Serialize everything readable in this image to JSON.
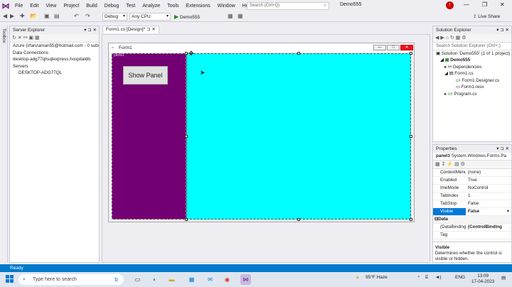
{
  "menu": {
    "items": [
      "File",
      "Edit",
      "View",
      "Project",
      "Build",
      "Debug",
      "Test",
      "Analyze",
      "Tools",
      "Extensions",
      "Window",
      "Help"
    ],
    "search_placeholder": "Search (Ctrl+Q)",
    "project_name": "Demo555",
    "user_initial": "!",
    "minimize": "—",
    "restore": "❐",
    "close": "✕"
  },
  "toolbar": {
    "config": "Debug",
    "platform": "Any CPU",
    "run_target": "Demo555",
    "live_share": "Live Share"
  },
  "toolbox_label": "Toolbox",
  "server_explorer": {
    "title": "Server Explorer",
    "items": [
      "Azure (irfanzaman55@hotmail.com - 0 subs",
      "Data Connections",
      "desktop-adg77ql\\sqlexpress.hospitaldb.",
      "Servers",
      "DESKTOP-ADG77QL"
    ]
  },
  "document": {
    "tab_label": "Form1.cs [Design]*",
    "form_title": "Form1",
    "panel_label": "panel1",
    "button_label": "Show Panel"
  },
  "solution_explorer": {
    "title": "Solution Explorer",
    "search_placeholder": "Search Solution Explorer (Ctrl+;)",
    "items": [
      {
        "text": "Solution 'Demo555' (1 of 1 project)",
        "indent": 0,
        "icon": "solution-icon"
      },
      {
        "text": "Demo555",
        "indent": 1,
        "icon": "csharp-project-icon"
      },
      {
        "text": "Dependencies",
        "indent": 2,
        "icon": "dependencies-icon"
      },
      {
        "text": "Form1.cs",
        "indent": 2,
        "icon": "form-icon"
      },
      {
        "text": "Form1.Designer.cs",
        "indent": 3,
        "icon": "csharp-file-icon"
      },
      {
        "text": "Form1.resx",
        "indent": 3,
        "icon": "resx-file-icon"
      },
      {
        "text": "Program.cs",
        "indent": 2,
        "icon": "csharp-file-icon"
      }
    ]
  },
  "properties": {
    "title": "Properties",
    "object_name": "panel1",
    "object_type": "System.Windows.Forms.Pa",
    "rows": [
      {
        "name": "ContextMenuS",
        "value": "(none)",
        "selected": false
      },
      {
        "name": "Enabled",
        "value": "True",
        "selected": false
      },
      {
        "name": "ImeMode",
        "value": "NoControl",
        "selected": false
      },
      {
        "name": "TabIndex",
        "value": "1",
        "selected": false
      },
      {
        "name": "TabStop",
        "value": "False",
        "selected": false
      },
      {
        "name": "Visible",
        "value": "False",
        "selected": true
      }
    ],
    "section_data": "Data",
    "data_rows": [
      {
        "name": "(DataBindings)",
        "value": "(ControlBinding"
      },
      {
        "name": "Tag",
        "value": ""
      }
    ],
    "desc_title": "Visible",
    "desc_text": "Determines whether the control is visible or hidden."
  },
  "status": {
    "text": "Ready"
  },
  "taskbar": {
    "search_placeholder": "Type here to search",
    "weather": "95°F Haze",
    "language": "ENG",
    "time": "13:09",
    "date": "17-04-2023"
  }
}
